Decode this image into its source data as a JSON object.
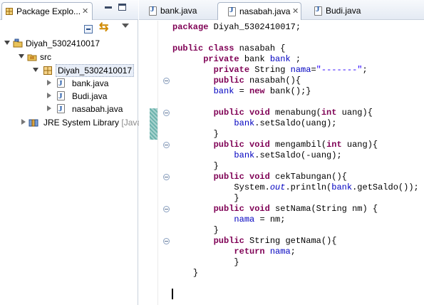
{
  "package_explorer": {
    "tab_title": "Package Explo...",
    "tree": {
      "project": "Diyah_5302410017",
      "src": "src",
      "package": "Diyah_5302410017",
      "files": [
        "bank.java",
        "Budi.java",
        "nasabah.java"
      ],
      "library": "JRE System Library [Java"
    }
  },
  "editor": {
    "tabs": [
      {
        "label": "bank.java",
        "active": false
      },
      {
        "label": "nasabah.java",
        "active": true
      },
      {
        "label": "Budi.java",
        "active": false
      }
    ],
    "code_lines": [
      "package Diyah_5302410017;",
      "",
      "public class nasabah {",
      "      private bank bank ;",
      "        private String nama=\"-------\";",
      "        public nasabah(){",
      "        bank = new bank();}",
      "",
      "        public void menabung(int uang){",
      "            bank.setSaldo(uang);",
      "        }",
      "        public void mengambil(int uang){",
      "            bank.setSaldo(-uang);",
      "        }",
      "        public void cekTabungan(){",
      "            System.out.println(bank.getSaldo());",
      "            }",
      "        public void setNama(String nm) {",
      "            nama = nm;",
      "        }",
      "        public String getNama(){",
      "            return nama;",
      "            }",
      "    }",
      "",
      ""
    ]
  },
  "colors": {
    "keyword": "#7f0055",
    "field": "#0000c0",
    "string": "#2a00ff",
    "selection_bg": "#e8eef8"
  }
}
